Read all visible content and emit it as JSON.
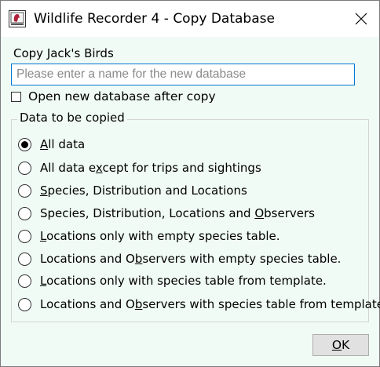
{
  "window": {
    "title": "Wildlife Recorder 4 - Copy Database",
    "icon": "app-logo-icon",
    "close_icon": "close-icon"
  },
  "source_caption": "Copy Jack's Birds",
  "name_input": {
    "value": "",
    "placeholder": "Please enter a name for the new database"
  },
  "open_after_copy": {
    "label": "Open new database after copy",
    "checked": false
  },
  "group": {
    "title": "Data to be copied",
    "options": [
      {
        "pre": "",
        "key": "A",
        "post": "ll data",
        "selected": true
      },
      {
        "pre": "All data e",
        "key": "x",
        "post": "cept for trips and sightings",
        "selected": false
      },
      {
        "pre": "",
        "key": "S",
        "post": "pecies, Distribution and Locations",
        "selected": false
      },
      {
        "pre": "Species, Distribution, Locations and ",
        "key": "O",
        "post": "bservers",
        "selected": false
      },
      {
        "pre": "",
        "key": "L",
        "post": "ocations only with empty species table.",
        "selected": false
      },
      {
        "pre": "Locations and O",
        "key": "b",
        "post": "servers with empty species table.",
        "selected": false
      },
      {
        "pre": "",
        "key": "L",
        "post": "ocations only with species table from template.",
        "selected": false
      },
      {
        "pre": "Locations and O",
        "key": "b",
        "post": "servers with species table from template.",
        "selected": false
      }
    ]
  },
  "ok_button": {
    "key": "O",
    "rest": "K"
  },
  "colors": {
    "dialog_bg": "#f0fbf5",
    "input_border": "#0078d7",
    "icon_red": "#b0203a"
  }
}
